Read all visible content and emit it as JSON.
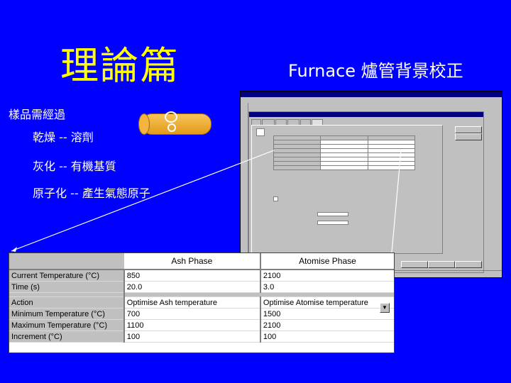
{
  "main_title": "理論篇",
  "right_title": "Furnace 爐管背景校正",
  "bullets": [
    "樣品需經過",
    "乾燥 -- 溶劑",
    "灰化 -- 有機基質",
    "原子化 -- 產生氣態原子"
  ],
  "colors": {
    "background": "#0000ff",
    "title": "#ffff00",
    "text": "#ffffff"
  },
  "zoom_table": {
    "headers": [
      "Ash Phase",
      "Atomise Phase"
    ],
    "rows": [
      {
        "label": "Current Temperature (°C)",
        "ash": "850",
        "atomise": "2100"
      },
      {
        "label": "Time (s)",
        "ash": "20.0",
        "atomise": "3.0"
      },
      {
        "label": "Action",
        "ash": "Optimise Ash temperature",
        "atomise": "Optimise Atomise temperature"
      },
      {
        "label": "Minimum Temperature (°C)",
        "ash": "700",
        "atomise": "1500"
      },
      {
        "label": "Maximum Temperature (°C)",
        "ash": "1100",
        "atomise": "2100"
      },
      {
        "label": "Increment (°C)",
        "ash": "100",
        "atomise": "100"
      }
    ]
  },
  "icons": {
    "dropdown": "dropdown-arrow-icon",
    "tube": "graphite-tube-icon"
  }
}
